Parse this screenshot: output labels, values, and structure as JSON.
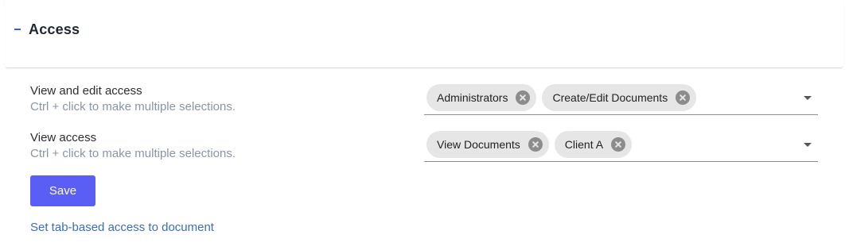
{
  "panel": {
    "title": "Access",
    "collapse_icon": "minus-icon"
  },
  "view_edit": {
    "label": "View and edit access",
    "hint": "Ctrl + click to make multiple selections.",
    "selected": [
      "Administrators",
      "Create/Edit Documents"
    ]
  },
  "view": {
    "label": "View access",
    "hint": "Ctrl + click to make multiple selections.",
    "selected": [
      "View Documents",
      "Client A"
    ]
  },
  "actions": {
    "save_label": "Save",
    "tab_access_link": "Set tab-based access to document"
  },
  "colors": {
    "accent": "#5b5ef5",
    "link": "#3a6fb8",
    "hint": "#8a95a8"
  }
}
